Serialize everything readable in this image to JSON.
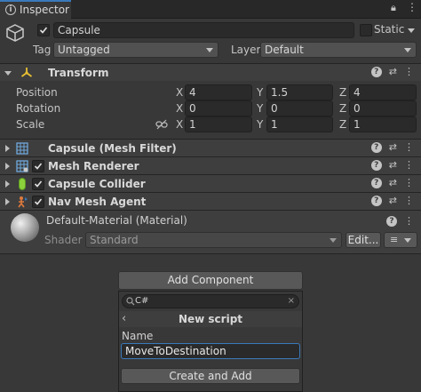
{
  "tab": {
    "label": "Inspector"
  },
  "object": {
    "name": "Capsule",
    "static_label": "Static",
    "tag_label": "Tag",
    "tag_value": "Untagged",
    "layer_label": "Layer",
    "layer_value": "Default"
  },
  "transform": {
    "title": "Transform",
    "rows": [
      {
        "label": "Position",
        "x": "4",
        "y": "1.5",
        "z": "4"
      },
      {
        "label": "Rotation",
        "x": "0",
        "y": "0",
        "z": "0"
      },
      {
        "label": "Scale",
        "x": "1",
        "y": "1",
        "z": "1"
      }
    ],
    "axes": [
      "X",
      "Y",
      "Z"
    ]
  },
  "components": [
    {
      "title": "Capsule (Mesh Filter)",
      "has_checkbox": false,
      "icon": "mesh-filter-icon"
    },
    {
      "title": "Mesh Renderer",
      "has_checkbox": true,
      "icon": "mesh-renderer-icon"
    },
    {
      "title": "Capsule Collider",
      "has_checkbox": true,
      "icon": "capsule-collider-icon"
    },
    {
      "title": "Nav Mesh Agent",
      "has_checkbox": true,
      "icon": "nav-mesh-agent-icon"
    }
  ],
  "material": {
    "title": "Default-Material (Material)",
    "shader_label": "Shader",
    "shader_value": "Standard",
    "edit_label": "Edit..."
  },
  "add_component": {
    "button_label": "Add Component",
    "search_value": "C#",
    "panel_title": "New script",
    "name_label": "Name",
    "name_value": "MoveToDestination",
    "create_label": "Create and Add"
  },
  "colors": {
    "accent": "#3a79bb",
    "transform_icon": "#e8c033",
    "collider_icon": "#8cd23c",
    "agent_icon": "#e07a3c",
    "mesh_icon": "#6fa8dc"
  }
}
